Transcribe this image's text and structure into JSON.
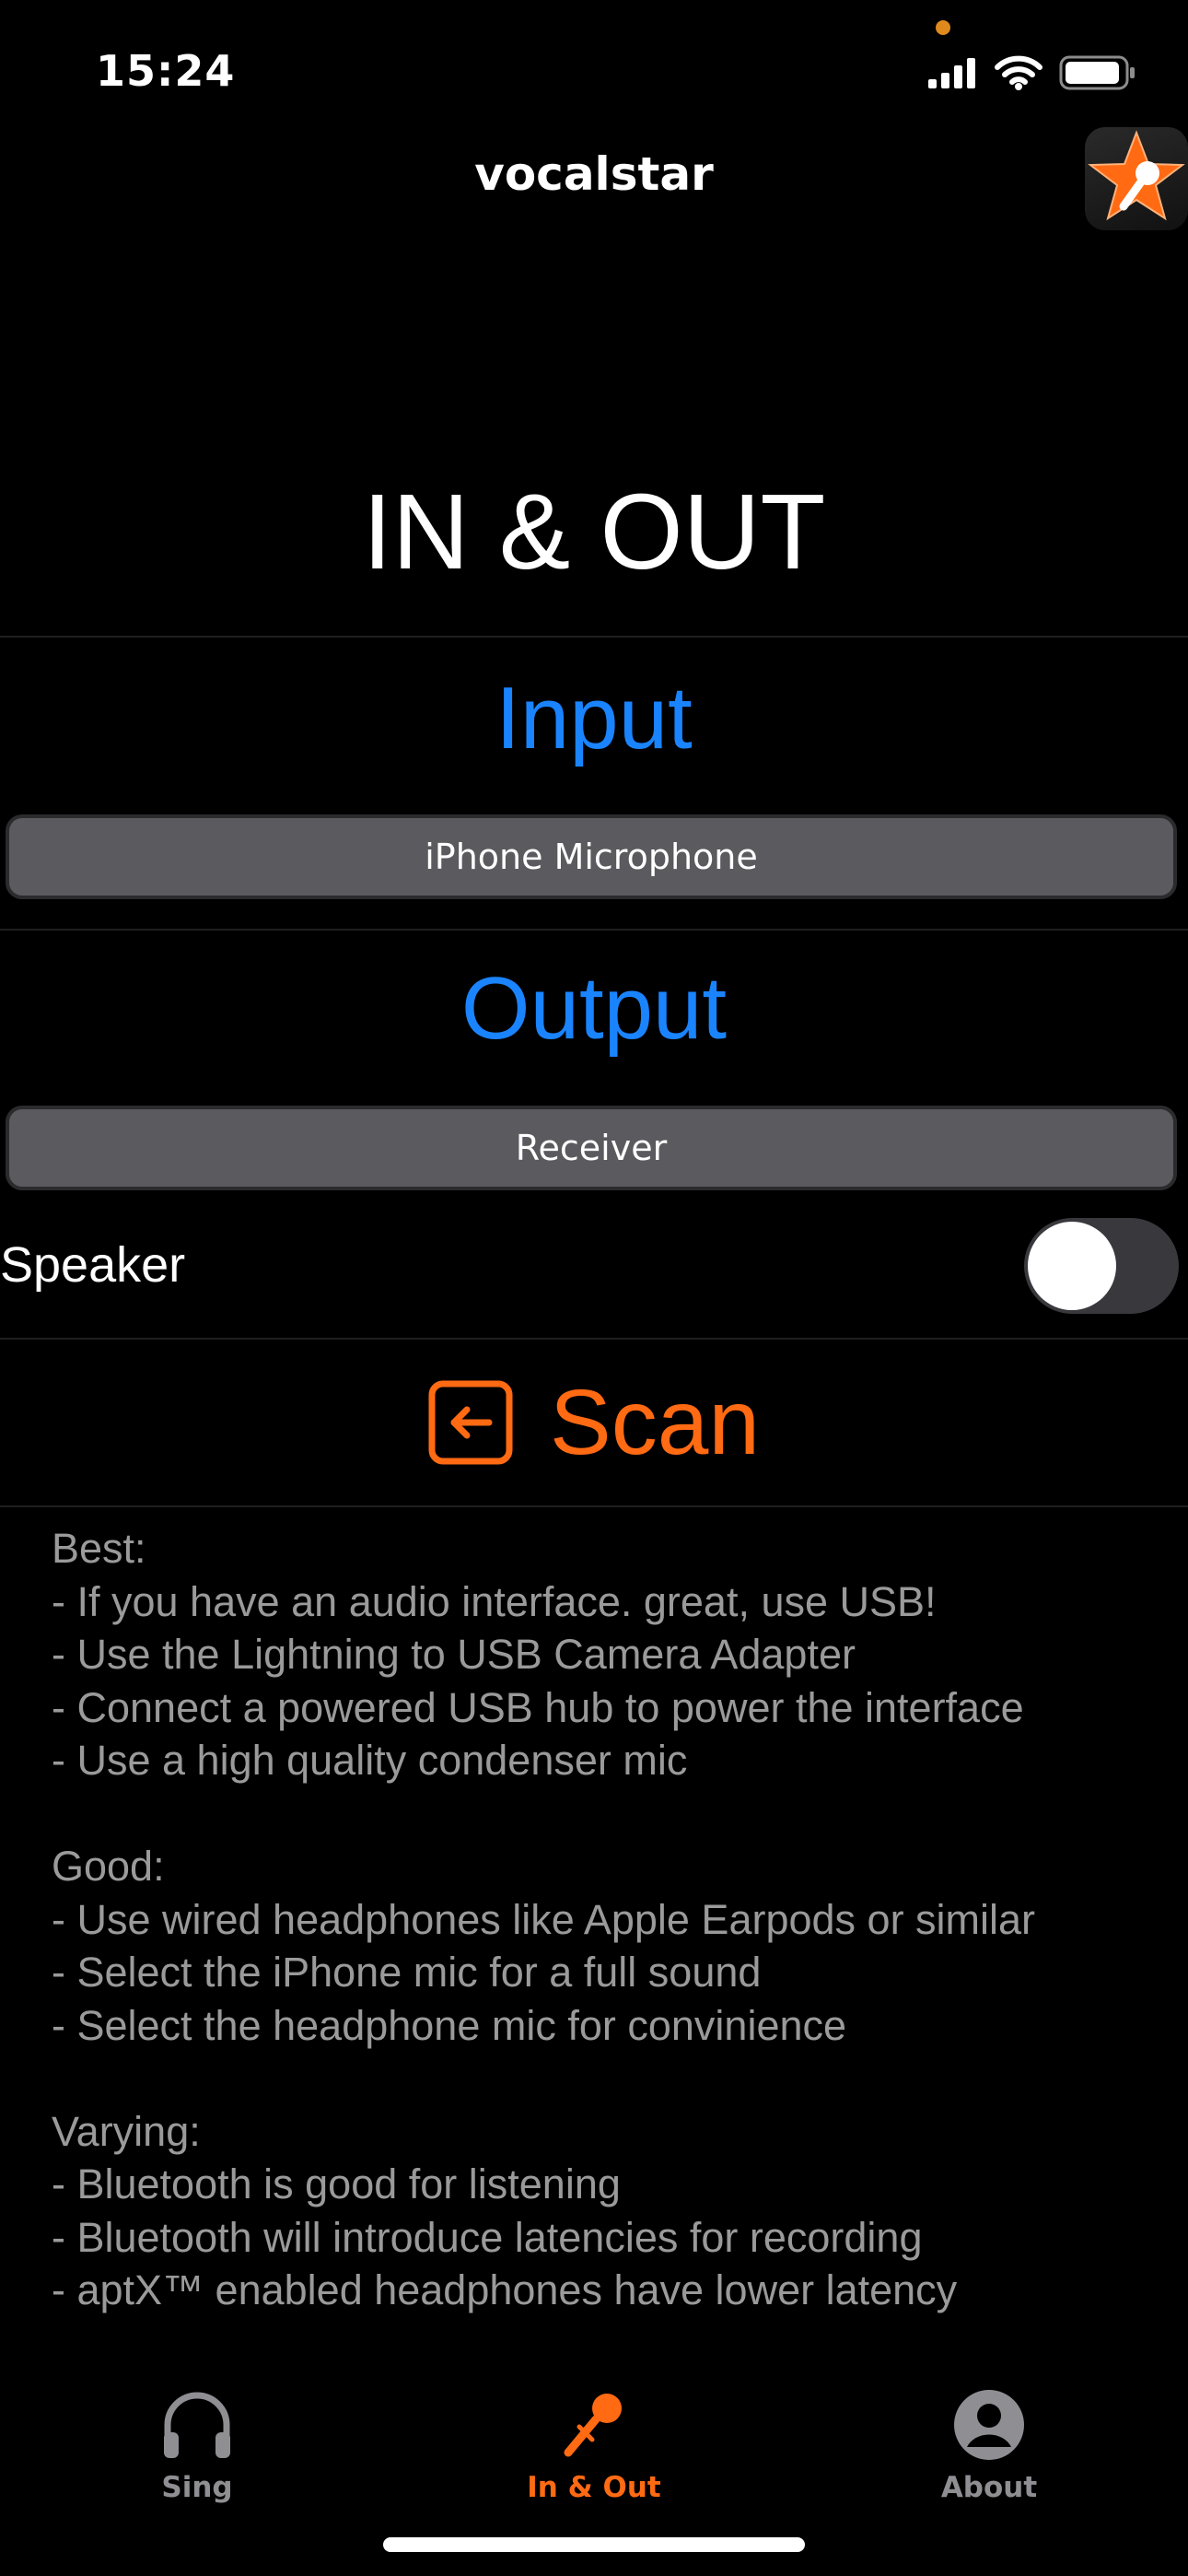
{
  "status_bar": {
    "time": "15:24"
  },
  "nav": {
    "title": "vocalstar",
    "logo_icon": "star-microphone-logo"
  },
  "page": {
    "title": "IN & OUT"
  },
  "input": {
    "heading": "Input",
    "selected": "iPhone Microphone"
  },
  "output": {
    "heading": "Output",
    "selected": "Receiver"
  },
  "speaker": {
    "label": "Speaker",
    "enabled": false
  },
  "scan": {
    "label": "Scan",
    "icon": "arrow-left-square-icon"
  },
  "info_text": "Best:\n- If you have an audio interface. great, use USB!\n- Use the Lightning to USB Camera Adapter\n- Connect a powered USB hub to power the interface\n- Use a high quality condenser mic\n\nGood:\n- Use wired headphones like Apple Earpods or similar\n- Select the iPhone mic for a full sound\n- Select the headphone mic for convinience\n\nVarying:\n- Bluetooth is good for listening\n- Bluetooth will introduce latencies for recording\n- aptX™ enabled headphones have lower latency",
  "tabs": [
    {
      "label": "Sing",
      "icon": "headphones-icon",
      "active": false
    },
    {
      "label": "In & Out",
      "icon": "microphone-icon",
      "active": true
    },
    {
      "label": "About",
      "icon": "person-circle-icon",
      "active": false
    }
  ],
  "colors": {
    "accent_blue": "#1a84ff",
    "accent_orange": "#ff6a13",
    "inactive_gray": "#8e8e93",
    "background": "#000000"
  }
}
